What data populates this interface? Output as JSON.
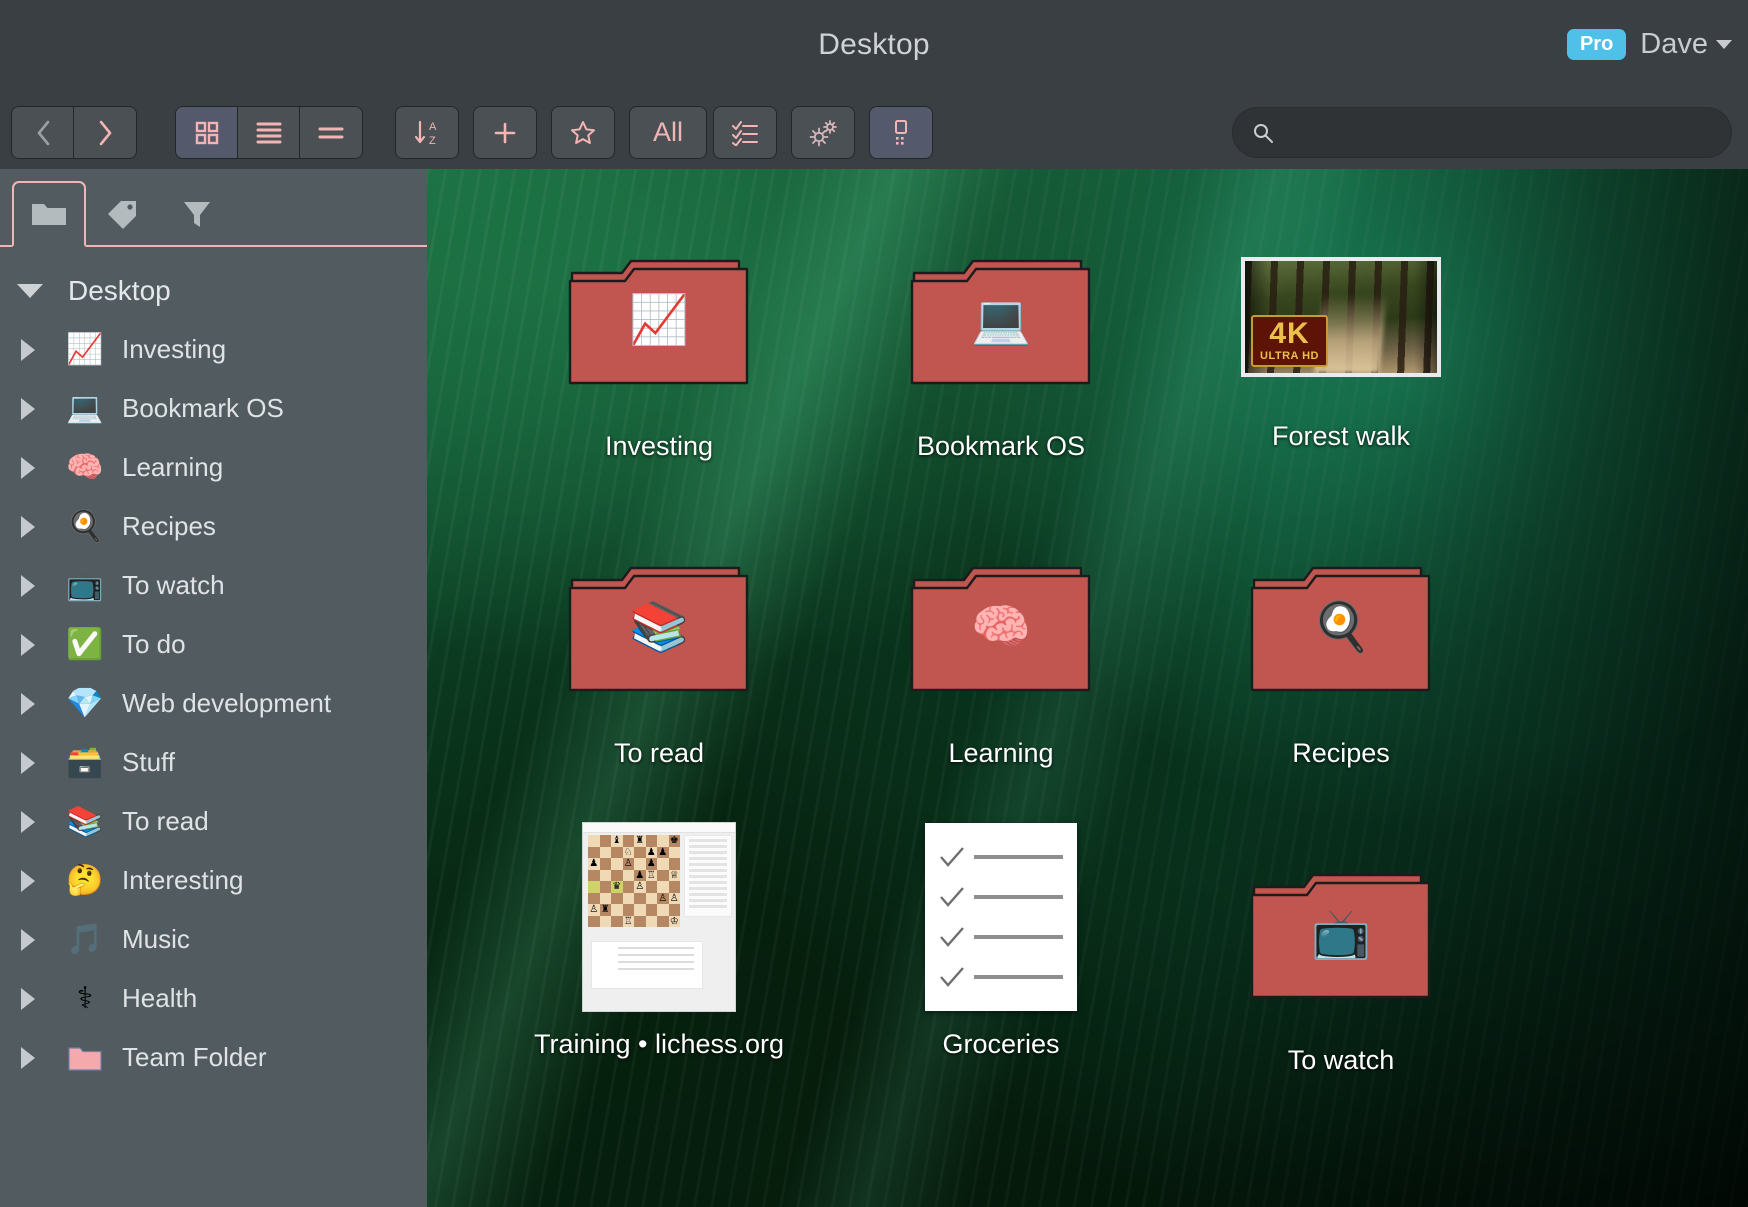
{
  "header": {
    "title": "Desktop",
    "pro_badge": "Pro",
    "user_name": "Dave"
  },
  "toolbar": {
    "back_label": "‹",
    "forward_label": "›",
    "grid_view_label": "grid-view",
    "list_view_label": "list-view",
    "compact_view_label": "compact-view",
    "sort_label": "sort-az",
    "add_label": "+",
    "star_label": "star",
    "all_label": "All",
    "checklist_label": "checklist",
    "settings_label": "settings",
    "select_label": "select-mode"
  },
  "search": {
    "value": "",
    "placeholder": ""
  },
  "sidebar": {
    "tabs": [
      {
        "name": "folders",
        "icon": "folder-icon",
        "active": true
      },
      {
        "name": "tags",
        "icon": "tag-icon",
        "active": false
      },
      {
        "name": "filters",
        "icon": "funnel-icon",
        "active": false
      }
    ],
    "root": {
      "label": "Desktop",
      "expanded": true
    },
    "items": [
      {
        "label": "Investing",
        "icon": "📈"
      },
      {
        "label": "Bookmark OS",
        "icon": "💻"
      },
      {
        "label": "Learning",
        "icon": "🧠"
      },
      {
        "label": "Recipes",
        "icon": "🍳"
      },
      {
        "label": "To watch",
        "icon": "📺"
      },
      {
        "label": "To do",
        "icon": "✅"
      },
      {
        "label": "Web development",
        "icon": "💎"
      },
      {
        "label": "Stuff",
        "icon": "🗃️"
      },
      {
        "label": "To read",
        "icon": "📚"
      },
      {
        "label": "Interesting",
        "icon": "🤔"
      },
      {
        "label": "Music",
        "icon": "🎵"
      },
      {
        "label": "Health",
        "icon": "⚕"
      },
      {
        "label": "Team Folder",
        "icon": "📁"
      }
    ]
  },
  "desktop": {
    "items": [
      {
        "label": "Investing",
        "type": "folder",
        "icon": "📈"
      },
      {
        "label": "Bookmark OS",
        "type": "folder",
        "icon": "💻"
      },
      {
        "label": "Forest walk",
        "type": "image",
        "badge_line1": "4K",
        "badge_line2": "ULTRA HD"
      },
      {
        "label": "To read",
        "type": "folder",
        "icon": "📚"
      },
      {
        "label": "Learning",
        "type": "folder",
        "icon": "🧠"
      },
      {
        "label": "Recipes",
        "type": "folder",
        "icon": "🍳"
      },
      {
        "label": "Training • lichess.org",
        "type": "screenshot"
      },
      {
        "label": "Groceries",
        "type": "checklist"
      },
      {
        "label": "To watch",
        "type": "folder",
        "icon": "📺"
      }
    ]
  },
  "colors": {
    "accent_pink": "#f2b4b4",
    "folder_red": "#c0564f",
    "pro_blue": "#4fc0e8",
    "sidebar_bg": "#525b60",
    "chrome_bg": "#3a3f43"
  }
}
